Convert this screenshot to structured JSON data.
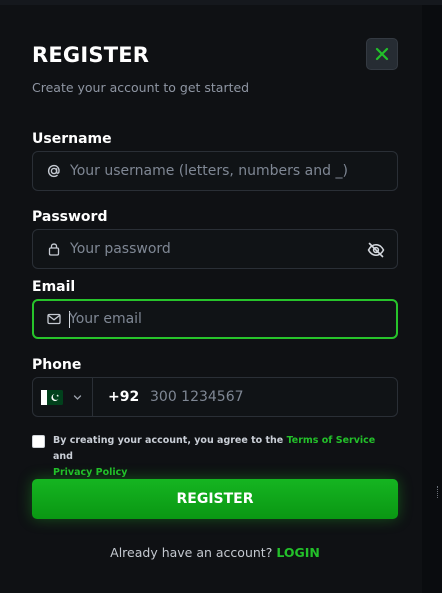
{
  "header": {
    "title": "REGISTER",
    "subtitle": "Create your account to get started",
    "close_icon": "x-icon"
  },
  "username": {
    "label": "Username",
    "placeholder": "Your username (letters, numbers and _)",
    "icon": "at-icon"
  },
  "password": {
    "label": "Password",
    "placeholder": "Your password",
    "icon": "lock-icon",
    "toggle_icon": "eye-off-icon"
  },
  "email": {
    "label": "Email",
    "placeholder": "Your email",
    "icon": "mail-icon",
    "focused": true
  },
  "phone": {
    "label": "Phone",
    "country_flag": "pakistan-flag-icon",
    "dial_code": "+92",
    "placeholder": "300 1234567"
  },
  "agreement": {
    "prefix": "By creating your account, you agree to the ",
    "terms_link": "Terms of Service",
    "middle": " and",
    "privacy_link": "Privacy Policy",
    "checked": false
  },
  "register_button": {
    "label": "REGISTER"
  },
  "footer": {
    "prompt": "Already have an account? ",
    "login_link": "LOGIN"
  },
  "colors": {
    "background": "#0f1114",
    "accent": "#23c02a",
    "focus_border": "#27c42b",
    "field_border": "#2a2f36",
    "text": "#ffffff",
    "muted_text": "#8f96a3"
  }
}
